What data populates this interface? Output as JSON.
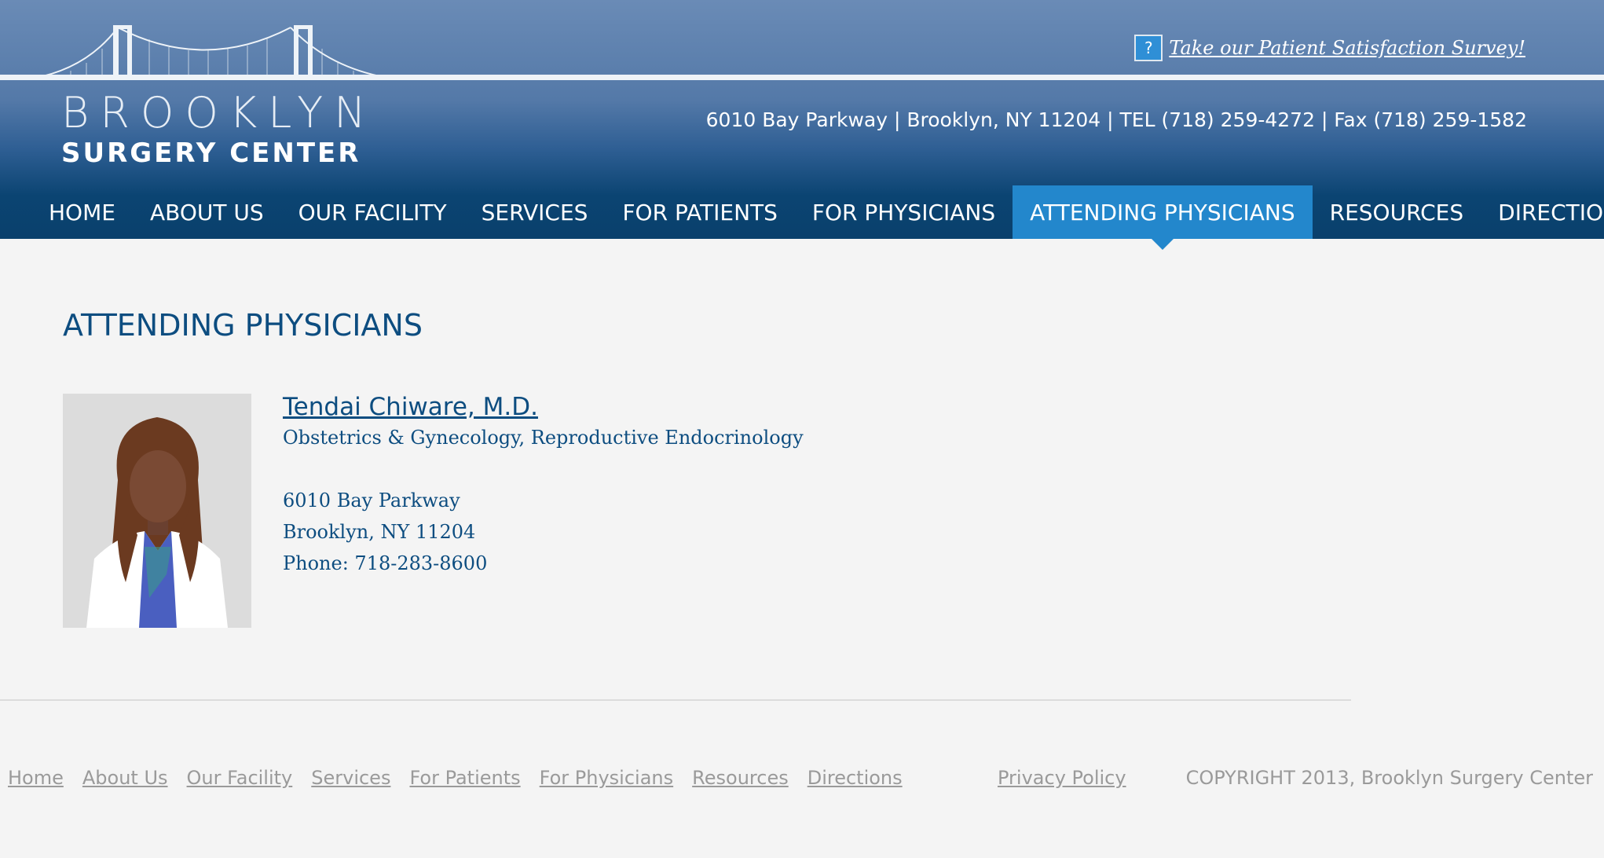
{
  "brand": {
    "line1": "BROOKLYN",
    "line2": "SURGERY CENTER"
  },
  "survey": {
    "icon_glyph": "?",
    "label": "Take our Patient Satisfaction Survey!"
  },
  "contact": "6010 Bay Parkway | Brooklyn, NY 11204 | TEL (718) 259-4272 | Fax (718) 259-1582",
  "nav": [
    {
      "label": "HOME"
    },
    {
      "label": "ABOUT US"
    },
    {
      "label": "OUR FACILITY"
    },
    {
      "label": "SERVICES"
    },
    {
      "label": "FOR PATIENTS"
    },
    {
      "label": "FOR PHYSICIANS"
    },
    {
      "label": "ATTENDING PHYSICIANS",
      "active": true
    },
    {
      "label": "RESOURCES"
    },
    {
      "label": "DIRECTIONS"
    }
  ],
  "page_title": "ATTENDING PHYSICIANS",
  "physician": {
    "name": "Tendai Chiware, M.D.",
    "specialty": "Obstetrics & Gynecology, Reproductive Endocrinology",
    "address1": "6010 Bay Parkway",
    "address2": "Brooklyn, NY 11204",
    "phone": "Phone: 718-283-8600"
  },
  "footer": {
    "links": [
      "Home",
      "About Us",
      "Our Facility",
      "Services",
      "For Patients",
      "For Physicians",
      "Resources",
      "Directions"
    ],
    "privacy": "Privacy Policy",
    "copyright": "COPYRIGHT 2013, Brooklyn Surgery Center"
  },
  "colors": {
    "header_dark": "#0a406c",
    "header_light": "#6a8bb6",
    "nav_active": "#2387cc",
    "title_text": "#0d4d80",
    "footer_text": "#9a9a9a"
  }
}
